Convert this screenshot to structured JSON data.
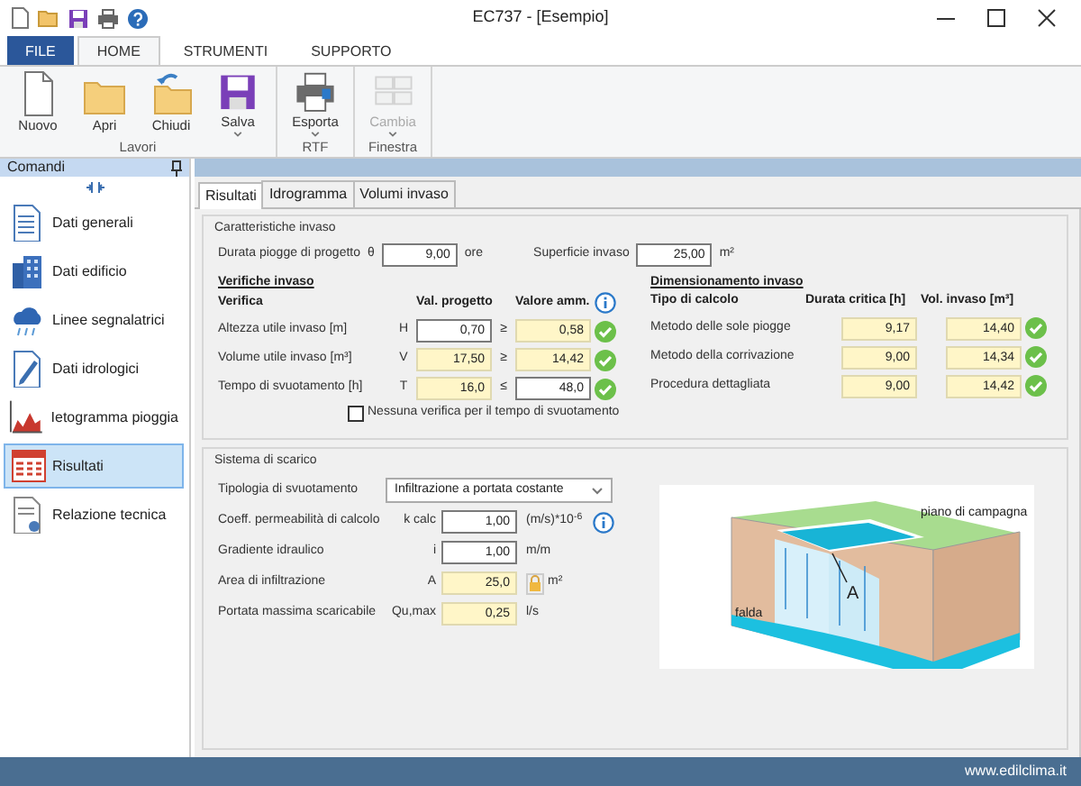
{
  "window": {
    "title": "EC737 - [Esempio]"
  },
  "ribbon": {
    "tabs": [
      {
        "label": "FILE",
        "kind": "file",
        "selected": false
      },
      {
        "label": "HOME",
        "kind": "tab",
        "selected": true
      },
      {
        "label": "STRUMENTI",
        "kind": "tab",
        "selected": false
      },
      {
        "label": "SUPPORTO",
        "kind": "tab",
        "selected": false
      }
    ],
    "groups": [
      {
        "label": "Lavori",
        "buttons": [
          {
            "label": "Nuovo",
            "dropdown": false,
            "disabled": false
          },
          {
            "label": "Apri",
            "dropdown": false,
            "disabled": false
          },
          {
            "label": "Chiudi",
            "dropdown": false,
            "disabled": false
          },
          {
            "label": "Salva",
            "dropdown": true,
            "disabled": false
          }
        ]
      },
      {
        "label": "RTF",
        "buttons": [
          {
            "label": "Esporta",
            "dropdown": true,
            "disabled": false
          }
        ]
      },
      {
        "label": "Finestra",
        "buttons": [
          {
            "label": "Cambia",
            "dropdown": true,
            "disabled": true
          }
        ]
      }
    ]
  },
  "sidebar": {
    "title": "Comandi",
    "items": [
      {
        "label": "Dati generali",
        "selected": false
      },
      {
        "label": "Dati edificio",
        "selected": false
      },
      {
        "label": "Linee segnalatrici",
        "selected": false
      },
      {
        "label": "Dati idrologici",
        "selected": false
      },
      {
        "label": "Ietogramma pioggia",
        "selected": false
      },
      {
        "label": "Risultati",
        "selected": true
      },
      {
        "label": "Relazione tecnica",
        "selected": false
      }
    ]
  },
  "tabs": [
    {
      "label": "Risultati",
      "selected": true
    },
    {
      "label": "Idrogramma",
      "selected": false
    },
    {
      "label": "Volumi invaso",
      "selected": false
    }
  ],
  "caratteristiche": {
    "title": "Caratteristiche invaso",
    "durata": {
      "label": "Durata piogge di progetto",
      "symbol": "θ",
      "value": "9,00",
      "unit": "ore"
    },
    "superficie": {
      "label": "Superficie invaso",
      "value": "25,00",
      "unit": "m²"
    },
    "verifiche": {
      "title": "Verifiche invaso",
      "columns": [
        "Verifica",
        "Val. progetto",
        "Valore amm."
      ],
      "rows": [
        {
          "label": "Altezza utile invaso [m]",
          "symbol": "H",
          "value": "0,70",
          "value_readonly": false,
          "operator": "≥",
          "limit": "0,58",
          "limit_readonly": true,
          "ok": true
        },
        {
          "label": "Volume utile invaso [m³]",
          "symbol": "V",
          "value": "17,50",
          "value_readonly": true,
          "operator": "≥",
          "limit": "14,42",
          "limit_readonly": true,
          "ok": true
        },
        {
          "label": "Tempo di svuotamento [h]",
          "symbol": "T",
          "value": "16,0",
          "value_readonly": true,
          "operator": "≤",
          "limit": "48,0",
          "limit_readonly": false,
          "ok": true
        }
      ]
    },
    "checkbox": {
      "label": "Nessuna verifica per il tempo di svuotamento",
      "checked": false
    },
    "dimensionamento": {
      "title": "Dimensionamento invaso",
      "columns": [
        "Tipo di calcolo",
        "Durata critica [h]",
        "Vol. invaso [m³]"
      ],
      "rows": [
        {
          "label": "Metodo delle sole piogge",
          "durata": "9,17",
          "volume": "14,40",
          "ok": true
        },
        {
          "label": "Metodo della corrivazione",
          "durata": "9,00",
          "volume": "14,34",
          "ok": true
        },
        {
          "label": "Procedura dettagliata",
          "durata": "9,00",
          "volume": "14,42",
          "ok": true
        }
      ]
    }
  },
  "sistema": {
    "title": "Sistema di scarico",
    "rows": [
      {
        "kind": "select",
        "label": "Tipologia di svuotamento",
        "value": "Infiltrazione a portata costante"
      },
      {
        "kind": "input",
        "label": "Coeff. permeabilità di calcolo",
        "symbol": "k calc",
        "value": "1,00",
        "unit": "(m/s)*10$^{-6}$",
        "readonly": false,
        "locked": false,
        "info": true
      },
      {
        "kind": "input",
        "label": "Gradiente idraulico",
        "symbol": "i",
        "value": "1,00",
        "unit": "m/m",
        "readonly": false,
        "locked": false,
        "info": false
      },
      {
        "kind": "input",
        "label": "Area di infiltrazione",
        "symbol": "A",
        "value": "25,0",
        "unit": "m²",
        "readonly": true,
        "locked": true,
        "info": false
      },
      {
        "kind": "input",
        "label": "Portata massima scaricabile",
        "symbol": "Qu,max",
        "value": "0,25",
        "unit": "l/s",
        "readonly": true,
        "locked": false,
        "info": false
      }
    ],
    "diagram": {
      "ground_label": "piano di campagna",
      "water_label": "falda",
      "area_label": "A"
    }
  },
  "footer": {
    "text": "www.edilclima.it"
  }
}
